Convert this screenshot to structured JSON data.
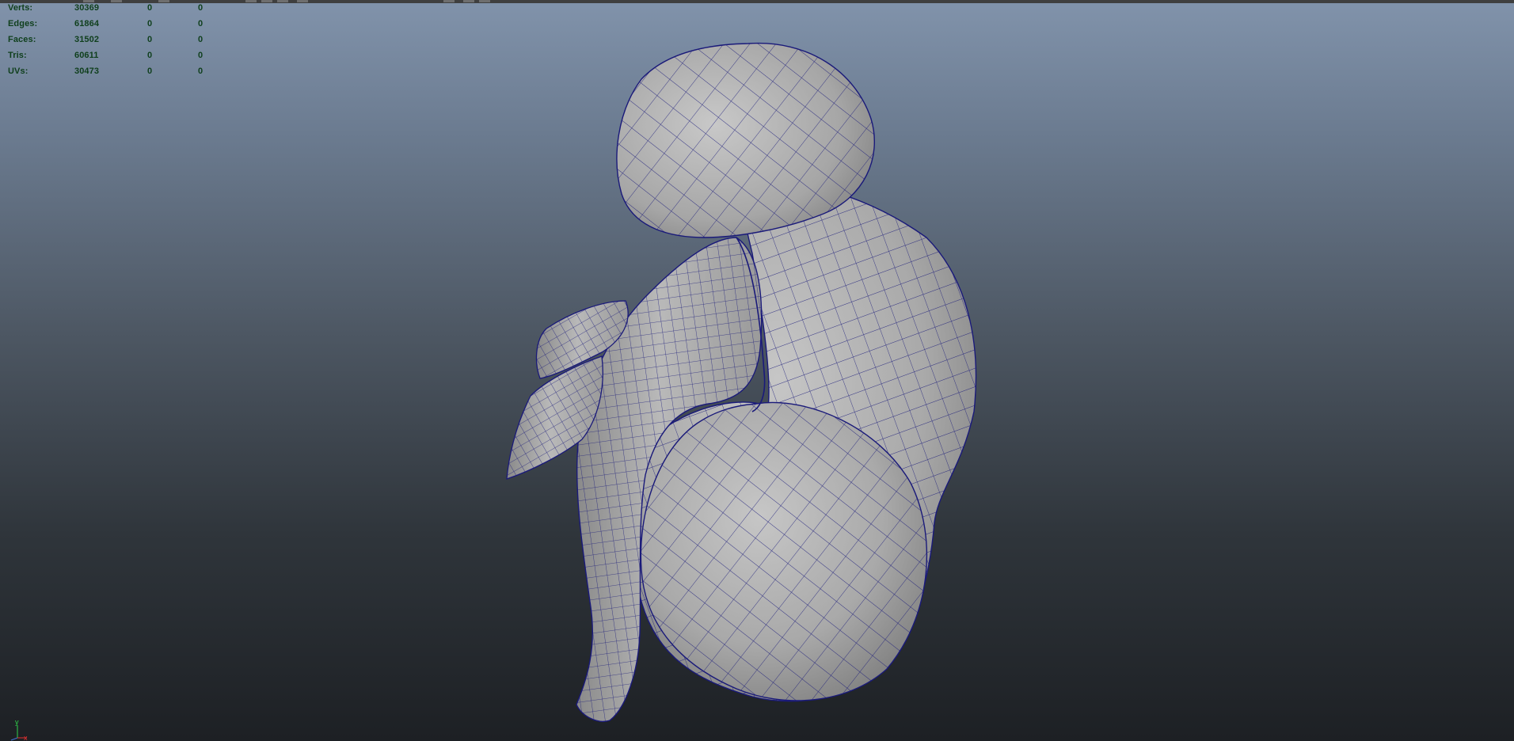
{
  "viewport": {
    "background_top": "#8193ab",
    "background_bottom": "#1d2024",
    "mesh_fill": "#b4b4b4",
    "wire_color": "#1a1a7a"
  },
  "heads_up_display": {
    "text_color": "#0f3f1c",
    "rows": [
      {
        "label": "Verts:",
        "values": [
          "30369",
          "0",
          "0"
        ]
      },
      {
        "label": "Edges:",
        "values": [
          "61864",
          "0",
          "0"
        ]
      },
      {
        "label": "Faces:",
        "values": [
          "31502",
          "0",
          "0"
        ]
      },
      {
        "label": "Tris:",
        "values": [
          "60611",
          "0",
          "0"
        ]
      },
      {
        "label": "UVs:",
        "values": [
          "30473",
          "0",
          "0"
        ]
      }
    ]
  },
  "axis_indicator": {
    "y_label": "y",
    "x_label": "x",
    "y_color": "#2fd34a",
    "x_color": "#e03030"
  },
  "mesh": {
    "name": "embryo-mesh",
    "display_mode": "smooth-shade-wireframe"
  }
}
